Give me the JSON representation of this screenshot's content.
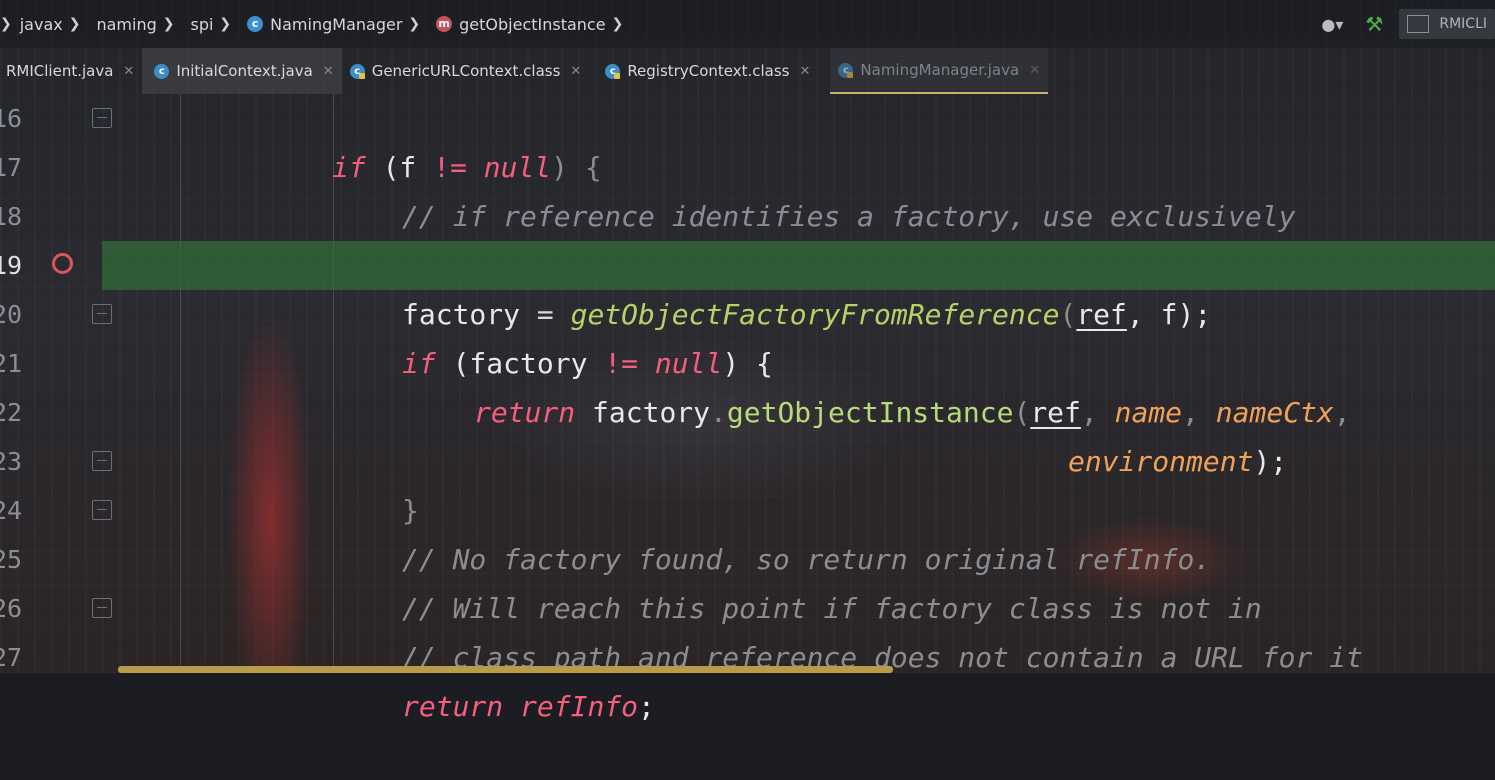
{
  "breadcrumb": {
    "items": [
      {
        "label": "javax",
        "icon": null
      },
      {
        "label": "naming",
        "icon": null
      },
      {
        "label": "spi",
        "icon": null
      },
      {
        "label": "NamingManager",
        "icon": "class-icon"
      },
      {
        "label": "getObjectInstance",
        "icon": "method-icon"
      }
    ]
  },
  "toolbar": {
    "run_config": "RMICLI"
  },
  "tabs": [
    {
      "label": "RMIClient.java",
      "state": "normal"
    },
    {
      "label": "InitialContext.java",
      "state": "active"
    },
    {
      "label": "GenericURLContext.class",
      "state": "normal"
    },
    {
      "label": "RegistryContext.class",
      "state": "normal"
    },
    {
      "label": "NamingManager.java",
      "state": "current"
    }
  ],
  "editor": {
    "line_numbers": [
      "16",
      "17",
      "18",
      "19",
      "20",
      "21",
      "22",
      "23",
      "24",
      "25",
      "26",
      "27"
    ],
    "breakpoint_line": "19",
    "code": {
      "l16": {
        "kw": "if",
        "a": " (f ",
        "op": "!=",
        "null": " null",
        "b": ") {"
      },
      "l17": "// if reference identifies a factory, use exclusively",
      "l19": {
        "v": "factory",
        "eq": " = ",
        "fn": "getObjectFactoryFromReference",
        "a": "(",
        "ref": "ref",
        "b": ", f);"
      },
      "l20": {
        "kw": "if",
        "a": " (factory ",
        "op": "!=",
        "null": " null",
        "b": ") {"
      },
      "l21": {
        "kw": "return",
        "a": " factory",
        "dot": ".",
        "m": "getObjectInstance",
        "p1": "(",
        "ref": "ref",
        "c1": ", ",
        "name": "name",
        "c2": ", ",
        "ctx": "nameCtx",
        "c3": ","
      },
      "l22": {
        "env": "environment",
        "end": ");"
      },
      "l23": "}",
      "l24": "// No factory found, so return original refInfo.",
      "l25": "// Will reach this point if factory class is not in",
      "l26": "// class path and reference does not contain a URL for it",
      "l27": {
        "kw": "return",
        "a": " refInfo",
        "b": ";"
      }
    }
  },
  "colors": {
    "keyword": "#f55f7c",
    "comment": "#8a8d93",
    "function": "#b6d36a",
    "parameter": "#f0a15a",
    "highlight": "#306e37",
    "breakpoint": "#d8565a"
  }
}
